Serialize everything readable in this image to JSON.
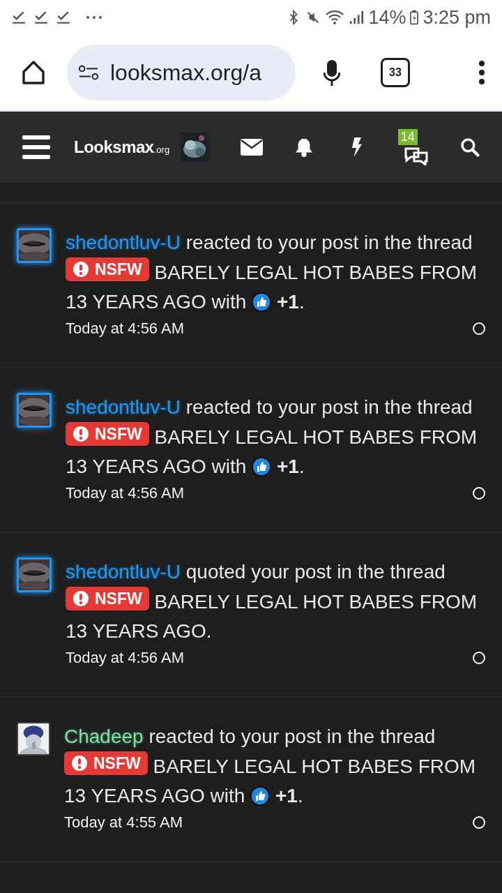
{
  "status_bar": {
    "battery": "14%",
    "time": "3:25 pm"
  },
  "browser": {
    "url": "looksmax.org/a",
    "tab_count": "33"
  },
  "nav": {
    "logo": "Looksmax",
    "logo_suffix": ".org",
    "alerts_badge": "14"
  },
  "notifications": [
    {
      "kind": "glow",
      "user": "shedontluv-U",
      "avatar_glow": true,
      "action": "reacted to your post in the thread",
      "prefix": "NSFW",
      "title": "BARELY LEGAL HOT BABES FROM 13 YEARS AGO",
      "with": "with",
      "reaction": "+1",
      "end": ".",
      "time": "Today at 4:56 AM"
    },
    {
      "kind": "glow",
      "user": "shedontluv-U",
      "avatar_glow": true,
      "action": "reacted to your post in the thread",
      "prefix": "NSFW",
      "title": "BARELY LEGAL HOT BABES FROM 13 YEARS AGO",
      "with": "with",
      "reaction": "+1",
      "end": ".",
      "time": "Today at 4:56 AM"
    },
    {
      "kind": "glow",
      "user": "shedontluv-U",
      "avatar_glow": true,
      "action": "quoted your post in the thread",
      "prefix": "NSFW",
      "title": "BARELY LEGAL HOT BABES FROM 13 YEARS AGO.",
      "time": "Today at 4:56 AM"
    },
    {
      "kind": "mint",
      "user": "Chadeep",
      "avatar_glow": false,
      "action": "reacted to your post in the thread",
      "prefix": "NSFW",
      "title": "BARELY LEGAL HOT BABES FROM 13 YEARS AGO",
      "with": "with",
      "reaction": "+1",
      "end": ".",
      "time": "Today at 4:55 AM"
    }
  ]
}
